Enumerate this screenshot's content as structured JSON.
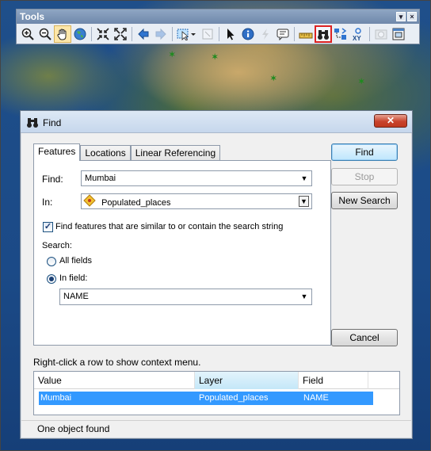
{
  "toolbar": {
    "title": "Tools",
    "menu_glyph": "▾",
    "close_glyph": "×",
    "tools": [
      {
        "name": "zoom-in-icon"
      },
      {
        "name": "zoom-out-icon"
      },
      {
        "name": "pan-hand-icon",
        "active": true
      },
      {
        "name": "full-extent-globe-icon"
      },
      {
        "name": "fixed-zoom-in-icon"
      },
      {
        "name": "fixed-zoom-out-icon"
      },
      {
        "name": "back-arrow-icon"
      },
      {
        "name": "forward-arrow-icon",
        "disabled": true
      },
      {
        "name": "select-features-icon"
      },
      {
        "name": "clear-selection-icon",
        "disabled": true
      },
      {
        "name": "select-elements-pointer-icon"
      },
      {
        "name": "identify-info-icon"
      },
      {
        "name": "hyperlink-lightning-icon",
        "disabled": true
      },
      {
        "name": "html-popup-icon"
      },
      {
        "name": "measure-ruler-icon"
      },
      {
        "name": "find-binoculars-icon",
        "highlighted": true
      },
      {
        "name": "find-route-icon"
      },
      {
        "name": "go-to-xy-icon"
      },
      {
        "name": "time-slider-icon",
        "disabled": true
      },
      {
        "name": "viewer-window-icon"
      }
    ]
  },
  "dialog": {
    "title": "Find",
    "close_label": "✕",
    "tabs": [
      {
        "label": "Features",
        "active": true
      },
      {
        "label": "Locations"
      },
      {
        "label": "Linear Referencing"
      }
    ],
    "find_label": "Find:",
    "find_value": "Mumbai",
    "in_label": "In:",
    "in_value": "Populated_places",
    "similar_checkbox_label": "Find features that are similar to or contain the search string",
    "similar_checked": true,
    "search_label": "Search:",
    "all_fields_label": "All fields",
    "in_field_label": "In field:",
    "selected_scope": "in_field",
    "field_value": "NAME",
    "buttons": {
      "find": "Find",
      "stop": "Stop",
      "new_search": "New Search",
      "cancel": "Cancel"
    },
    "results_hint": "Right-click a row to show context menu.",
    "results_columns": [
      "Value",
      "Layer",
      "Field"
    ],
    "results_rows": [
      {
        "value": "Mumbai",
        "layer": "Populated_places",
        "field": "NAME"
      }
    ],
    "status": "One object found"
  }
}
